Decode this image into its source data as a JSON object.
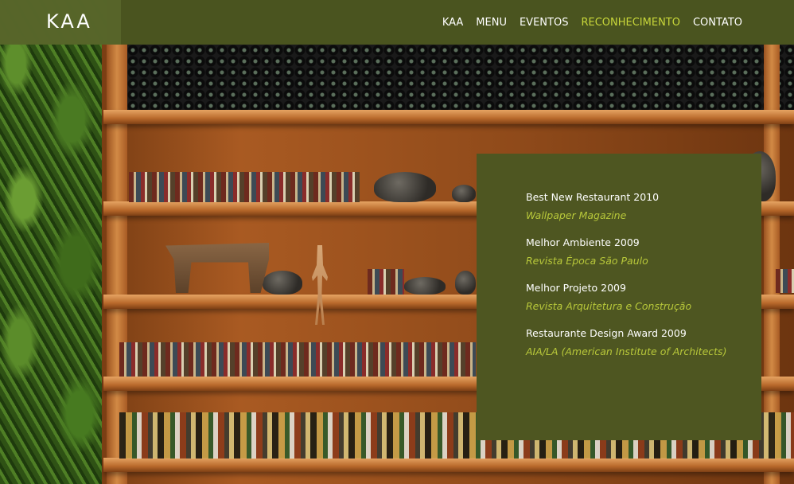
{
  "brand": {
    "logo_text": "KAA"
  },
  "nav": {
    "items": [
      {
        "label": "KAA",
        "active": false
      },
      {
        "label": "MENU",
        "active": false
      },
      {
        "label": "EVENTOS",
        "active": false
      },
      {
        "label": "RECONHECIMENTO",
        "active": true
      },
      {
        "label": "CONTATO",
        "active": false
      }
    ]
  },
  "awards": [
    {
      "title": "Best New Restaurant 2010",
      "source": "Wallpaper Magazine"
    },
    {
      "title": "Melhor Ambiente 2009",
      "source": "Revista Época São Paulo"
    },
    {
      "title": "Melhor Projeto 2009",
      "source": "Revista Arquitetura e Construção"
    },
    {
      "title": "Restaurante Design Award 2009",
      "source": "AIA/LA (American Institute of Architects)"
    }
  ],
  "colors": {
    "header_bg": "#4e5c22",
    "panel_bg": "#4e5621",
    "accent": "#c8d63a",
    "award_source": "#b8c83a"
  }
}
